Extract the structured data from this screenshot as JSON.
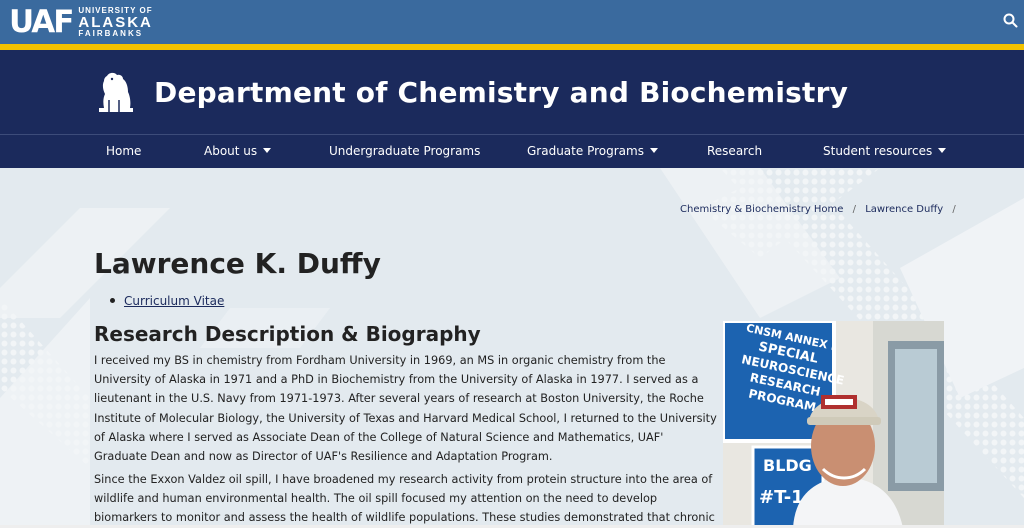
{
  "header": {
    "logo_mark": "UAF",
    "logo_line1": "UNIVERSITY OF",
    "logo_line2": "ALASKA",
    "logo_line3": "FAIRBANKS",
    "search_icon": "search-icon"
  },
  "banner": {
    "title": "Department of Chemistry and Biochemistry",
    "logo_icon": "polar-bear-icon"
  },
  "nav": {
    "items": [
      {
        "label": "Home",
        "dropdown": false
      },
      {
        "label": "About us",
        "dropdown": true
      },
      {
        "label": "Undergraduate Programs",
        "dropdown": false
      },
      {
        "label": "Graduate Programs",
        "dropdown": true
      },
      {
        "label": "Research",
        "dropdown": false
      },
      {
        "label": "Student resources",
        "dropdown": true
      }
    ]
  },
  "breadcrumb": {
    "items": [
      "Chemistry & Biochemistry Home",
      "Lawrence Duffy"
    ],
    "separator": "/"
  },
  "main": {
    "title": "Lawrence K. Duffy",
    "links": [
      "Curriculum Vitae"
    ],
    "section_title": "Research Description & Biography",
    "paragraphs": [
      "I received my BS in chemistry from Fordham University in 1969, an MS in organic chemistry from the University of Alaska in 1971 and a PhD in Biochemistry from the University of Alaska in 1977. I served as a lieutenant in the U.S. Navy from 1971-1973. After several years of research at Boston University, the Roche Institute of Molecular Biology, the University of Texas and Harvard Medical School, I returned to the University of Alaska where I served as Associate Dean of the College of Natural Science and Mathematics, UAF' Graduate Dean and now as Director of UAF's Resilience and Adaptation Program.",
      "Since the Exxon Valdez oil spill, I have broadened my research activity from protein structure into the area of wildlife and human environmental health. The oil spill focused my attention on the need to develop biomarkers to monitor and assess the health of wildlife populations. These studies demonstrated that chronic exposure could be measured"
    ],
    "photo": {
      "sign_line1": "CNSM ANNEX I",
      "sign_line2": "SPECIAL",
      "sign_line3": "NEUROSCIENCE",
      "sign_line4": "RESEARCH",
      "sign_line5": "PROGRAM",
      "bldg_line1": "BLDG",
      "bldg_line2": "#T-1"
    }
  },
  "colors": {
    "topbar": "#3a6a9e",
    "accent_gold": "#f2c200",
    "navy": "#1b2a5c",
    "background": "#e3eaef"
  }
}
